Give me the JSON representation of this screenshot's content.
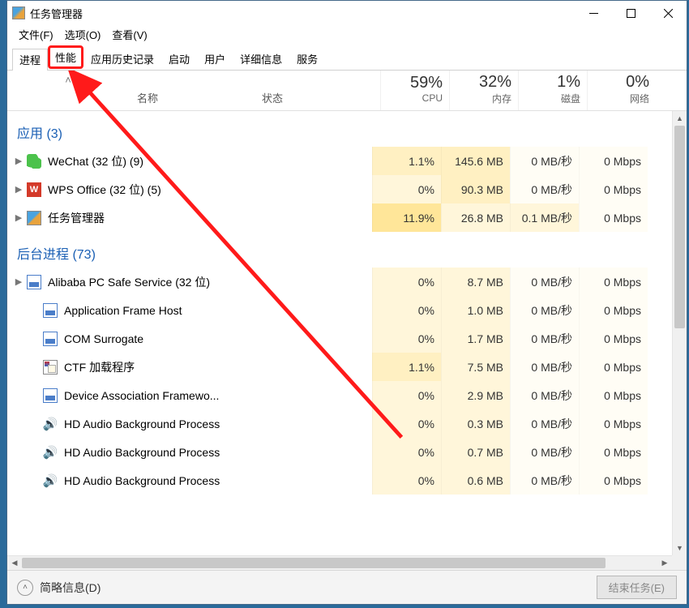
{
  "window": {
    "title": "任务管理器"
  },
  "menu": {
    "file": "文件(F)",
    "options": "选项(O)",
    "view": "查看(V)"
  },
  "tabs": {
    "processes": "进程",
    "performance": "性能",
    "app_history": "应用历史记录",
    "startup": "启动",
    "users": "用户",
    "details": "详细信息",
    "services": "服务"
  },
  "headers": {
    "name": "名称",
    "status": "状态",
    "cpu_pct": "59%",
    "cpu": "CPU",
    "mem_pct": "32%",
    "mem": "内存",
    "disk_pct": "1%",
    "disk": "磁盘",
    "net_pct": "0%",
    "net": "网络"
  },
  "groups": {
    "apps": "应用 (3)",
    "background": "后台进程 (73)"
  },
  "rows": {
    "wechat": {
      "name": "WeChat (32 位) (9)",
      "cpu": "1.1%",
      "mem": "145.6 MB",
      "disk": "0 MB/秒",
      "net": "0 Mbps"
    },
    "wps": {
      "name": "WPS Office (32 位) (5)",
      "cpu": "0%",
      "mem": "90.3 MB",
      "disk": "0 MB/秒",
      "net": "0 Mbps"
    },
    "taskmgr": {
      "name": "任务管理器",
      "cpu": "11.9%",
      "mem": "26.8 MB",
      "disk": "0.1 MB/秒",
      "net": "0 Mbps"
    },
    "alibaba": {
      "name": "Alibaba PC Safe Service (32 位)",
      "cpu": "0%",
      "mem": "8.7 MB",
      "disk": "0 MB/秒",
      "net": "0 Mbps"
    },
    "afh": {
      "name": "Application Frame Host",
      "cpu": "0%",
      "mem": "1.0 MB",
      "disk": "0 MB/秒",
      "net": "0 Mbps"
    },
    "com": {
      "name": "COM Surrogate",
      "cpu": "0%",
      "mem": "1.7 MB",
      "disk": "0 MB/秒",
      "net": "0 Mbps"
    },
    "ctf": {
      "name": "CTF 加载程序",
      "cpu": "1.1%",
      "mem": "7.5 MB",
      "disk": "0 MB/秒",
      "net": "0 Mbps"
    },
    "daf": {
      "name": "Device Association Framewo...",
      "cpu": "0%",
      "mem": "2.9 MB",
      "disk": "0 MB/秒",
      "net": "0 Mbps"
    },
    "hd1": {
      "name": "HD Audio Background Process",
      "cpu": "0%",
      "mem": "0.3 MB",
      "disk": "0 MB/秒",
      "net": "0 Mbps"
    },
    "hd2": {
      "name": "HD Audio Background Process",
      "cpu": "0%",
      "mem": "0.7 MB",
      "disk": "0 MB/秒",
      "net": "0 Mbps"
    },
    "hd3": {
      "name": "HD Audio Background Process",
      "cpu": "0%",
      "mem": "0.6 MB",
      "disk": "0 MB/秒",
      "net": "0 Mbps"
    }
  },
  "statusbar": {
    "fewer_details": "简略信息(D)",
    "end_task": "结束任务(E)"
  }
}
